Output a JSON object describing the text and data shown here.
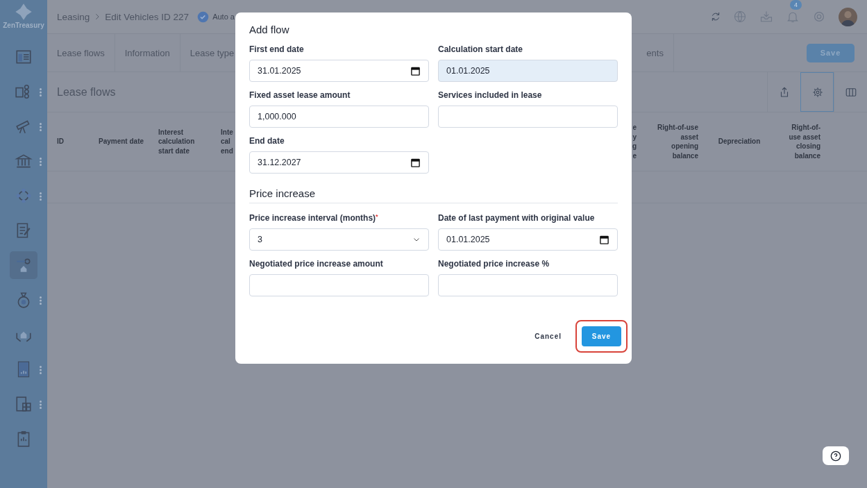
{
  "app": {
    "logo_text": "ZenTreasury"
  },
  "sidebar": {
    "items": [
      {
        "has_submenu": false,
        "selected": false
      },
      {
        "has_submenu": true,
        "selected": false
      },
      {
        "has_submenu": true,
        "selected": false
      },
      {
        "has_submenu": true,
        "selected": false
      },
      {
        "has_submenu": true,
        "selected": false
      },
      {
        "has_submenu": false,
        "selected": false
      },
      {
        "has_submenu": false,
        "selected": true
      },
      {
        "has_submenu": true,
        "selected": false
      },
      {
        "has_submenu": false,
        "selected": false
      },
      {
        "has_submenu": true,
        "selected": false
      },
      {
        "has_submenu": true,
        "selected": false
      },
      {
        "has_submenu": false,
        "selected": false
      }
    ]
  },
  "header": {
    "breadcrumb": [
      "Leasing",
      "Edit Vehicles ID 227"
    ],
    "status_text": "Auto a",
    "notification_count": "4"
  },
  "tabs": [
    {
      "label": "Lease flows"
    },
    {
      "label": "Information"
    },
    {
      "label": "Lease type"
    },
    {
      "label": "ents"
    }
  ],
  "save_button": "Save",
  "section_title": "Lease flows",
  "toolbar": [
    {
      "selected": false
    },
    {
      "selected": true
    },
    {
      "selected": false
    }
  ],
  "table": {
    "columns": [
      "ID",
      "Payment date",
      "Interest calculation start date",
      "Inte\ncal\nend",
      "e\ny\ng\ne",
      "Right-of-use asset opening balance",
      "Depreciation",
      "Right-of-use asset closing balance"
    ]
  },
  "dialog": {
    "title": "Add flow",
    "fields": [
      {
        "label": "First end date",
        "kind": "date",
        "value": "31.01.2025",
        "highlighted": false
      },
      {
        "label": "Calculation start date",
        "kind": "text",
        "value": "01.01.2025",
        "highlighted": true
      },
      {
        "label": "Fixed asset lease amount",
        "kind": "text",
        "value": "1,000.000",
        "highlighted": false
      },
      {
        "label": "Services included in lease",
        "kind": "text",
        "highlighted": false
      },
      {
        "label": "End date",
        "kind": "date",
        "value": "31.12.2027",
        "highlighted": false
      }
    ],
    "section": "Price increase",
    "section_fields": [
      {
        "label": "Price increase interval (months)",
        "required_mark": "*",
        "kind": "select",
        "value": "3",
        "highlighted": false
      },
      {
        "label": "Date of last payment with original value",
        "kind": "date",
        "value": "01.01.2025",
        "highlighted": false
      },
      {
        "label": "Negotiated price increase amount",
        "kind": "text",
        "highlighted": false
      },
      {
        "label": "Negotiated price increase %",
        "kind": "text",
        "highlighted": false
      }
    ],
    "cancel": "Cancel",
    "save": "Save",
    "save_highlighted": true
  }
}
